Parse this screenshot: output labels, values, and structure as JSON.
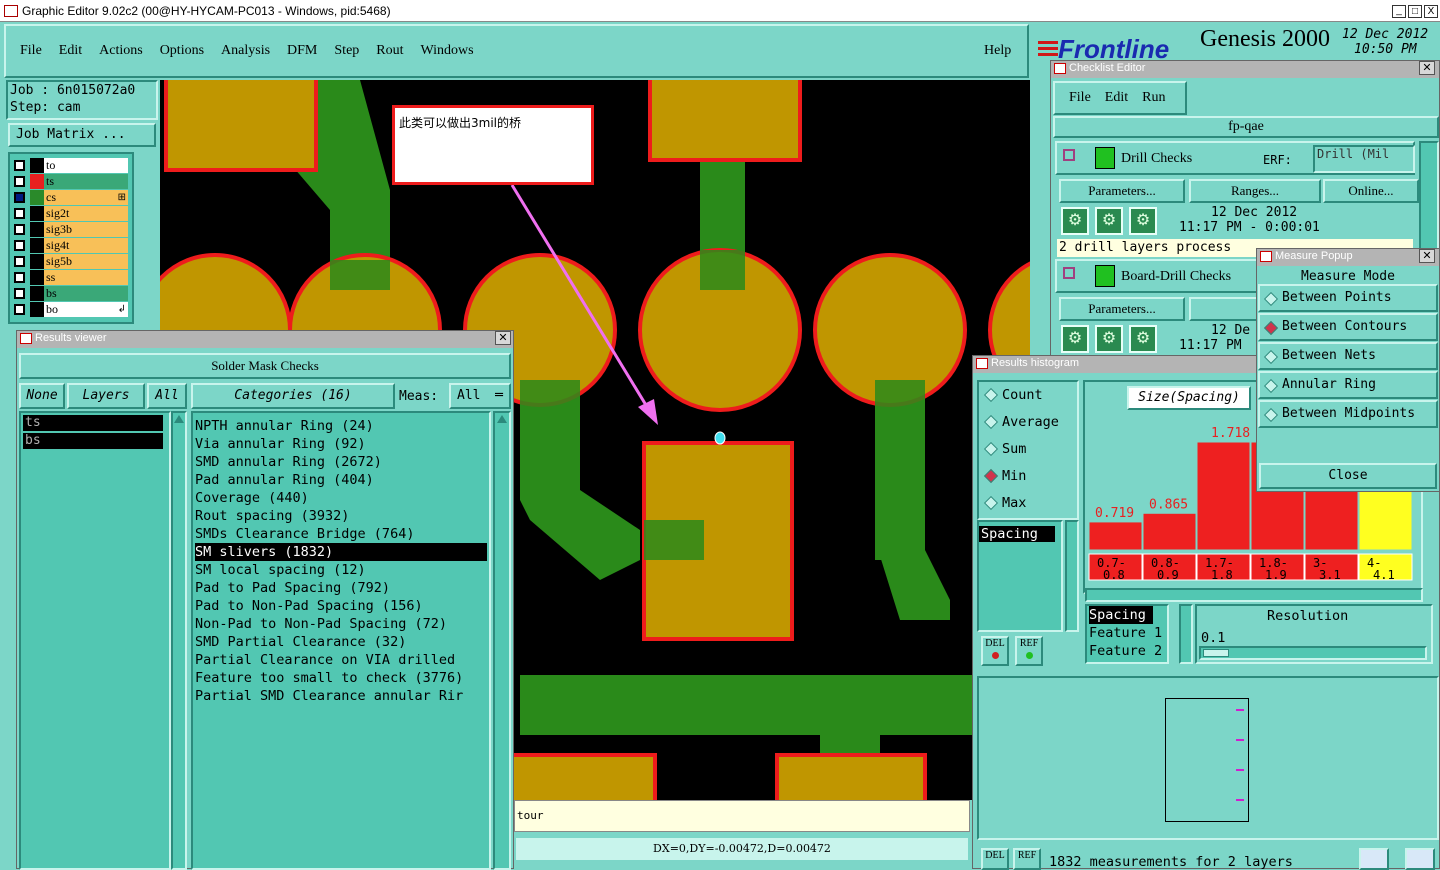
{
  "window": {
    "title": "Graphic Editor 9.02c2 (00@HY-HYCAM-PC013 - Windows, pid:5468)",
    "controls": [
      "_",
      "□",
      "X"
    ]
  },
  "menu": {
    "items": [
      "File",
      "Edit",
      "Actions",
      "Options",
      "Analysis",
      "DFM",
      "Step",
      "Rout",
      "Windows"
    ],
    "help": "Help"
  },
  "brand": {
    "logo": "Frontline",
    "product": "Genesis 2000",
    "date": "12 Dec 2012",
    "time": "10:50 PM"
  },
  "job": {
    "job_line": "Job : 6n015072a0",
    "step_line": "Step: cam",
    "matrix_button": "Job Matrix ..."
  },
  "layers": [
    {
      "name": "to",
      "swatch": "#000000",
      "bg": "#ffffff"
    },
    {
      "name": "ts",
      "swatch": "#e82020",
      "bg": "#3aa878"
    },
    {
      "name": "cs",
      "swatch": "#2a8a2a",
      "bg": "#f8c058",
      "mark": "⊞"
    },
    {
      "name": "sig2t",
      "swatch": "#000000",
      "bg": "#f8c058"
    },
    {
      "name": "sig3b",
      "swatch": "#000000",
      "bg": "#f8c058"
    },
    {
      "name": "sig4t",
      "swatch": "#000000",
      "bg": "#f8c058"
    },
    {
      "name": "sig5b",
      "swatch": "#000000",
      "bg": "#f8c058"
    },
    {
      "name": "ss",
      "swatch": "#000000",
      "bg": "#f8c058"
    },
    {
      "name": "bs",
      "swatch": "#000000",
      "bg": "#3aa878"
    },
    {
      "name": "bo",
      "swatch": "#000000",
      "bg": "#ffffff",
      "mark": "↲"
    }
  ],
  "annotation": {
    "text": "此类可以做出3mil的桥"
  },
  "results_viewer": {
    "title": "Results viewer",
    "header": "Solder Mask Checks",
    "none_btn": "None",
    "layers_btn": "Layers",
    "all_btn": "All",
    "categories_label": "Categories (16)",
    "meas_label": "Meas:",
    "meas_value": "All",
    "selected_layers": [
      "ts",
      "bs"
    ],
    "categories": [
      "NPTH annular Ring (24)",
      "Via annular Ring (92)",
      "SMD annular Ring (2672)",
      "Pad annular Ring (404)",
      "Coverage (440)",
      "Rout spacing (3932)",
      "SMDs Clearance Bridge (764)",
      "SM slivers (1832)",
      "SM local spacing (12)",
      "Pad to Pad Spacing (792)",
      "Pad to Non-Pad Spacing (156)",
      "Non-Pad to Non-Pad Spacing (72)",
      "SMD Partial Clearance (32)",
      "Partial Clearance on VIA drilled",
      "Feature too small to check (3776)",
      "Partial SMD Clearance annular Rir"
    ],
    "selected_index": 7
  },
  "status": {
    "prompt": "tour",
    "readout": "DX=0,DY=-0.00472,D=0.00472"
  },
  "checklist": {
    "title": "Checklist Editor",
    "menu": [
      "File",
      "Edit",
      "Run"
    ],
    "name": "fp-qae",
    "check1": {
      "label": "Drill Checks",
      "erf_label": "ERF:",
      "erf_value": "Drill (Mil",
      "params": "Parameters...",
      "ranges": "Ranges...",
      "online": "Online...",
      "date": "12 Dec 2012",
      "time": "11:17 PM - 0:00:01",
      "status": "2 drill layers process"
    },
    "check2": {
      "label": "Board-Drill Checks",
      "params": "Parameters...",
      "ranges": "Rang",
      "date": "12 De",
      "time": "11:17 PM"
    }
  },
  "measure_popup": {
    "title": "Measure Popup",
    "mode_label": "Measure Mode",
    "options": [
      "Between Points",
      "Between Contours",
      "Between Nets",
      "Annular Ring",
      "Between Midpoints"
    ],
    "selected_index": 1,
    "close": "Close"
  },
  "histogram": {
    "title": "Results histogram",
    "stats": [
      "Count",
      "Average",
      "Sum",
      "Min",
      "Max"
    ],
    "selected_stat": 3,
    "size_label": "Size(Spacing)",
    "list_item": "Spacing",
    "del": "DEL",
    "ref": "REF",
    "resolution_label": "Resolution",
    "resolution_value": "0.1",
    "fields": [
      "Spacing",
      "Feature 1",
      "Feature 2"
    ],
    "footer": "1832 measurements for 2 layers"
  },
  "chart_data": {
    "type": "bar",
    "categories": [
      "0.7-0.8",
      "0.8-0.9",
      "1.7-1.8",
      "1.8-1.9",
      "3-3.1",
      "4-4.1"
    ],
    "values": [
      0.719,
      0.865,
      1.718,
      null,
      null,
      null
    ],
    "value_labels": [
      "0.719",
      "0.865",
      "1.718",
      "",
      "",
      ""
    ],
    "bar_colors": [
      "#ee2020",
      "#ee2020",
      "#ee2020",
      "#ee2020",
      "#ee2020",
      "#ffff20"
    ],
    "bar_heights_rel": [
      0.26,
      0.34,
      1.0,
      1.0,
      1.0,
      1.0
    ]
  }
}
